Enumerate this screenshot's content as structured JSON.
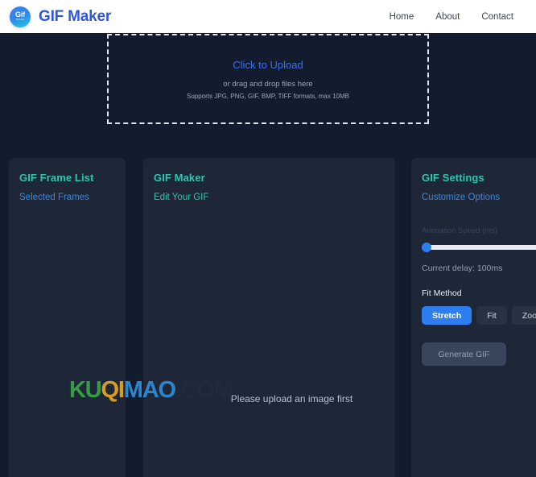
{
  "header": {
    "logo_text": "Gif",
    "logo_sub": "MAKER",
    "title": "GIF Maker",
    "nav": [
      {
        "label": "Home"
      },
      {
        "label": "About"
      },
      {
        "label": "Contact"
      }
    ]
  },
  "upload": {
    "title": "Click to Upload",
    "hint": "or drag and drop files here",
    "formats": "Supports JPG, PNG, GIF, BMP, TIFF formats, max 10MB"
  },
  "frame_list_panel": {
    "title": "GIF Frame List",
    "subtitle": "Selected Frames"
  },
  "gif_maker_panel": {
    "title": "GIF Maker",
    "subtitle": "Edit Your GIF",
    "empty_message": "Please upload an image first"
  },
  "settings_panel": {
    "title": "GIF Settings",
    "subtitle": "Customize Options",
    "speed_label": "Animation Speed (ms)",
    "speed_value": 100,
    "speed_min": 50,
    "speed_max": 1000,
    "current_delay": "Current delay: 100ms",
    "fit_method_label": "Fit Method",
    "fit_methods": [
      {
        "label": "Stretch",
        "active": true
      },
      {
        "label": "Fit",
        "active": false
      },
      {
        "label": "Zoom",
        "active": false
      }
    ],
    "generate_label": "Generate GIF"
  },
  "watermark": {
    "letters": [
      {
        "ch": "K",
        "color": "#3aa647"
      },
      {
        "ch": "U",
        "color": "#3aa647"
      },
      {
        "ch": "Q",
        "color": "#e8a81c"
      },
      {
        "ch": "I",
        "color": "#e8a81c"
      },
      {
        "ch": "M",
        "color": "#2f8fd8"
      },
      {
        "ch": "A",
        "color": "#2f8fd8"
      },
      {
        "ch": "O",
        "color": "#2f8fd8"
      },
      {
        "ch": ".",
        "color": "#222b3c"
      },
      {
        "ch": "C",
        "color": "#222b3c"
      },
      {
        "ch": "O",
        "color": "#222b3c"
      },
      {
        "ch": "M",
        "color": "#222b3c"
      }
    ]
  },
  "colors": {
    "page_bg": "#131c2e",
    "panel_bg": "#1e2737",
    "header_bg": "#ffffff",
    "brand": "#2f58d6",
    "accent_teal": "#2ec6b0",
    "accent_blue": "#2f7ef0"
  }
}
